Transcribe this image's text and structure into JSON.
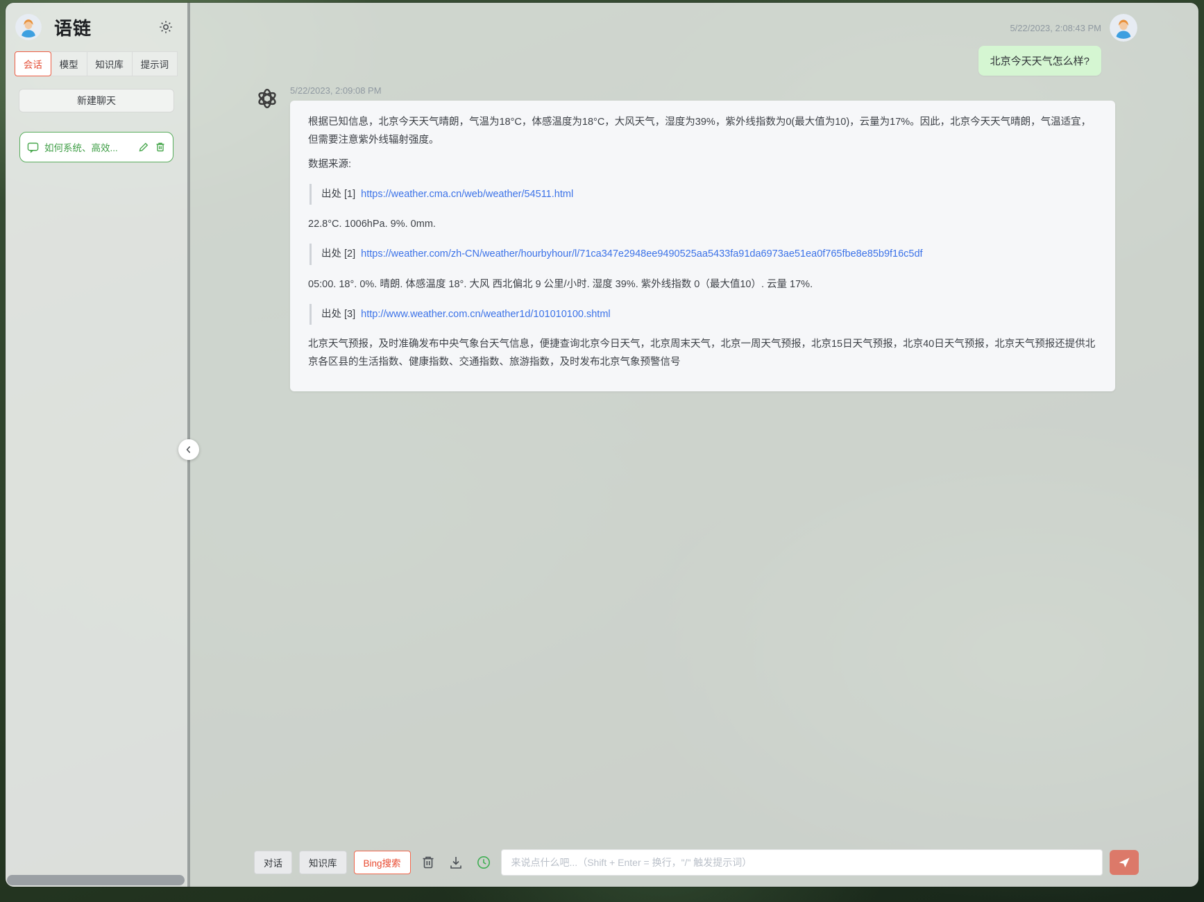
{
  "app": {
    "title": "语链"
  },
  "sidebar": {
    "tabs": [
      {
        "label": "会话",
        "active": true
      },
      {
        "label": "模型",
        "active": false
      },
      {
        "label": "知识库",
        "active": false
      },
      {
        "label": "提示词",
        "active": false
      }
    ],
    "new_chat_label": "新建聊天",
    "conversations": [
      {
        "title": "如何系统、高效..."
      }
    ]
  },
  "chat": {
    "user_message": {
      "timestamp": "5/22/2023, 2:08:43 PM",
      "text": "北京今天天气怎么样?"
    },
    "assistant_message": {
      "timestamp": "5/22/2023, 2:09:08 PM",
      "paragraph1": "根据已知信息，北京今天天气晴朗，气温为18°C，体感温度为18°C，大风天气，湿度为39%，紫外线指数为0(最大值为10)，云量为17%。因此，北京今天天气晴朗，气温适宜，但需要注意紫外线辐射强度。",
      "sources_heading": "数据来源:",
      "citations": [
        {
          "label": "出处 [1]",
          "url": "https://weather.cma.cn/web/weather/54511.html",
          "excerpt": "22.8°C. 1006hPa. 9%. 0mm."
        },
        {
          "label": "出处 [2]",
          "url": "https://weather.com/zh-CN/weather/hourbyhour/l/71ca347e2948ee9490525aa5433fa91da6973ae51ea0f765fbe8e85b9f16c5df",
          "excerpt": "05:00. 18°. 0%. 晴朗. 体感温度 18°. 大风 西北偏北 9 公里/小时. 湿度 39%. 紫外线指数 0（最大值10）. 云量 17%."
        },
        {
          "label": "出处 [3]",
          "url": "http://www.weather.com.cn/weather1d/101010100.shtml",
          "excerpt": "北京天气预报，及时准确发布中央气象台天气信息，便捷查询北京今日天气，北京周末天气，北京一周天气预报，北京15日天气预报，北京40日天气预报，北京天气预报还提供北京各区县的生活指数、健康指数、交通指数、旅游指数，及时发布北京气象预警信号"
        }
      ]
    }
  },
  "composer": {
    "mode_buttons": [
      {
        "label": "对话",
        "active": false
      },
      {
        "label": "知识库",
        "active": false
      },
      {
        "label": "Bing搜索",
        "active": true
      }
    ],
    "placeholder": "来说点什么吧...（Shift + Enter = 换行，\"/\" 触发提示词）"
  },
  "colors": {
    "accent_red": "#e8492f",
    "conversation_green": "#4aa84f",
    "user_bubble_green": "#d5f6d2",
    "link_blue": "#3b72e8",
    "send_button_salmon": "#e6806e"
  }
}
